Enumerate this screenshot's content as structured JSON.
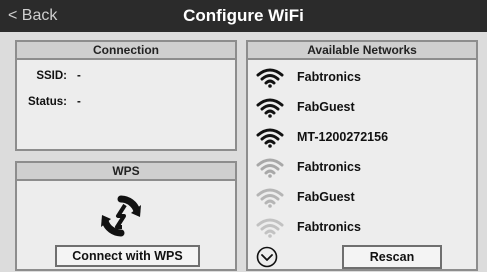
{
  "header": {
    "back_label": "< Back",
    "title": "Configure WiFi"
  },
  "connection": {
    "title": "Connection",
    "ssid_label": "SSID:",
    "ssid_value": "-",
    "status_label": "Status:",
    "status_value": "-"
  },
  "wps": {
    "title": "WPS",
    "icon": "wps-icon",
    "button_label": "Connect with WPS"
  },
  "networks": {
    "title": "Available Networks",
    "items": [
      {
        "name": "Fabtronics",
        "signal": "strong",
        "icon": "wifi-icon"
      },
      {
        "name": "FabGuest",
        "signal": "strong",
        "icon": "wifi-icon"
      },
      {
        "name": "MT-1200272156",
        "signal": "strong",
        "icon": "wifi-icon"
      },
      {
        "name": "Fabtronics",
        "signal": "weak",
        "icon": "wifi-icon"
      },
      {
        "name": "FabGuest",
        "signal": "weak",
        "icon": "wifi-icon"
      },
      {
        "name": "Fabtronics",
        "signal": "weak",
        "icon": "wifi-icon"
      }
    ],
    "more_icon": "chevron-down-icon",
    "rescan_label": "Rescan"
  },
  "colors": {
    "titlebar": "#2b2b2b",
    "panel_bg": "#ededed",
    "panel_header": "#cfcfcf",
    "strong_signal": "#111111",
    "weak_signal": "#a8a8a8"
  }
}
